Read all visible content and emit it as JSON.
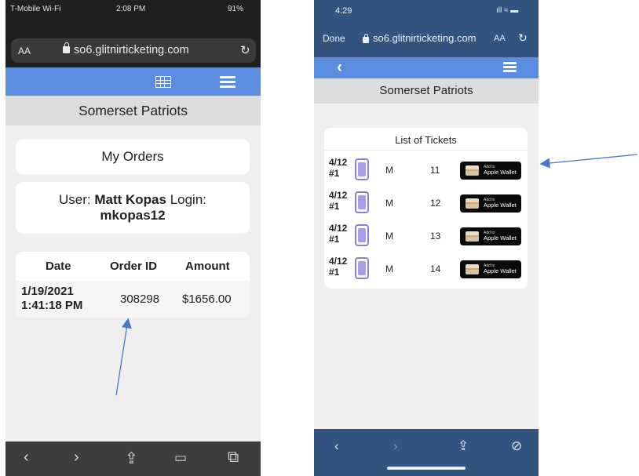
{
  "left_phone": {
    "status": {
      "carrier": "T-Mobile Wi-Fi",
      "time": "2:08 PM",
      "battery": "91%"
    },
    "browser": {
      "text_size": "AA",
      "url": "so6.glitnirticketing.com",
      "reload_icon": "reload-icon"
    },
    "nav": {
      "calendar_icon": "grid-icon",
      "menu_icon": "menu-icon"
    },
    "team_title": "Somerset Patriots",
    "orders_heading": "My Orders",
    "user": {
      "user_label": "User:",
      "user_name": "Matt Kopas",
      "login_label": "Login:",
      "login_name": "mkopas12"
    },
    "orders_table": {
      "headers": [
        "Date",
        "Order ID",
        "Amount"
      ],
      "rows": [
        {
          "date_line1": "1/19/2021",
          "date_line2": "1:41:18 PM",
          "order_id": "308298",
          "amount": "$1656.00"
        }
      ]
    },
    "toolbar": {
      "back": "‹",
      "forward": "›",
      "share": "⇪",
      "bookmarks": "📖",
      "tabs": "⧉"
    }
  },
  "right_phone": {
    "status": {
      "time": "4:29",
      "signal": "ıll ≈ ▬"
    },
    "browser": {
      "done": "Done",
      "url": "so6.glitnirticketing.com",
      "text_size": "AA",
      "reload": "↻"
    },
    "nav": {
      "back": "‹"
    },
    "team_title": "Somerset Patriots",
    "tickets_heading": "List of Tickets",
    "tickets": [
      {
        "date": "4/12",
        "game": "#1",
        "section": "M",
        "seat": "11"
      },
      {
        "date": "4/12",
        "game": "#1",
        "section": "M",
        "seat": "12"
      },
      {
        "date": "4/12",
        "game": "#1",
        "section": "M",
        "seat": "13"
      },
      {
        "date": "4/12",
        "game": "#1",
        "section": "M",
        "seat": "14"
      }
    ],
    "wallet_button": {
      "line1": "Add to",
      "line2": "Apple Wallet"
    },
    "toolbar": {
      "back": "‹",
      "forward": "›",
      "share": "⇪",
      "compass": "⊘"
    }
  },
  "colors": {
    "nav_blue": "#5b8ce0",
    "dark_bar": "#33547f",
    "arrow": "#4a78c9"
  }
}
